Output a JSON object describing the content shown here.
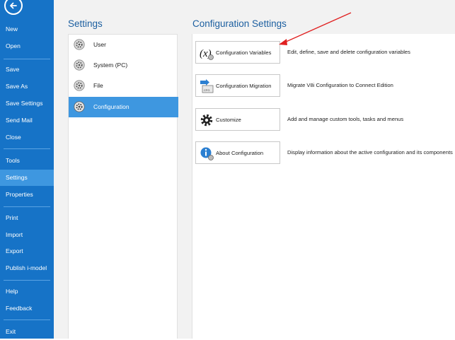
{
  "sidebar": {
    "items": [
      {
        "label": "New"
      },
      {
        "label": "Open"
      },
      {
        "label": "Save"
      },
      {
        "label": "Save As"
      },
      {
        "label": "Save Settings"
      },
      {
        "label": "Send Mail"
      },
      {
        "label": "Close"
      },
      {
        "label": "Tools"
      },
      {
        "label": "Settings"
      },
      {
        "label": "Properties"
      },
      {
        "label": "Print"
      },
      {
        "label": "Import"
      },
      {
        "label": "Export"
      },
      {
        "label": "Publish i-model"
      },
      {
        "label": "Help"
      },
      {
        "label": "Feedback"
      },
      {
        "label": "Exit"
      }
    ],
    "active": "Settings"
  },
  "settings": {
    "title": "Settings",
    "items": [
      {
        "label": "User"
      },
      {
        "label": "System (PC)"
      },
      {
        "label": "File"
      },
      {
        "label": "Configuration"
      }
    ],
    "active": "Configuration"
  },
  "config": {
    "title": "Configuration Settings",
    "rows": [
      {
        "button": "Configuration Variables",
        "icon": "variable-x-icon",
        "description": "Edit, define, save and delete configuration variables"
      },
      {
        "button": "Configuration Migration",
        "icon": "migration-arrow-icon",
        "description": "Migrate V8i Configuration to Connect Edition"
      },
      {
        "button": "Customize",
        "icon": "gear-icon",
        "description": "Add and manage custom tools, tasks and menus"
      },
      {
        "button": "About Configuration",
        "icon": "info-icon",
        "description": "Display information about the active configuration and its components"
      }
    ]
  },
  "colors": {
    "sidebar": "#1673c7",
    "active": "#3e97e0",
    "title": "#1c5fa0",
    "annotation_arrow": "#e02020"
  }
}
